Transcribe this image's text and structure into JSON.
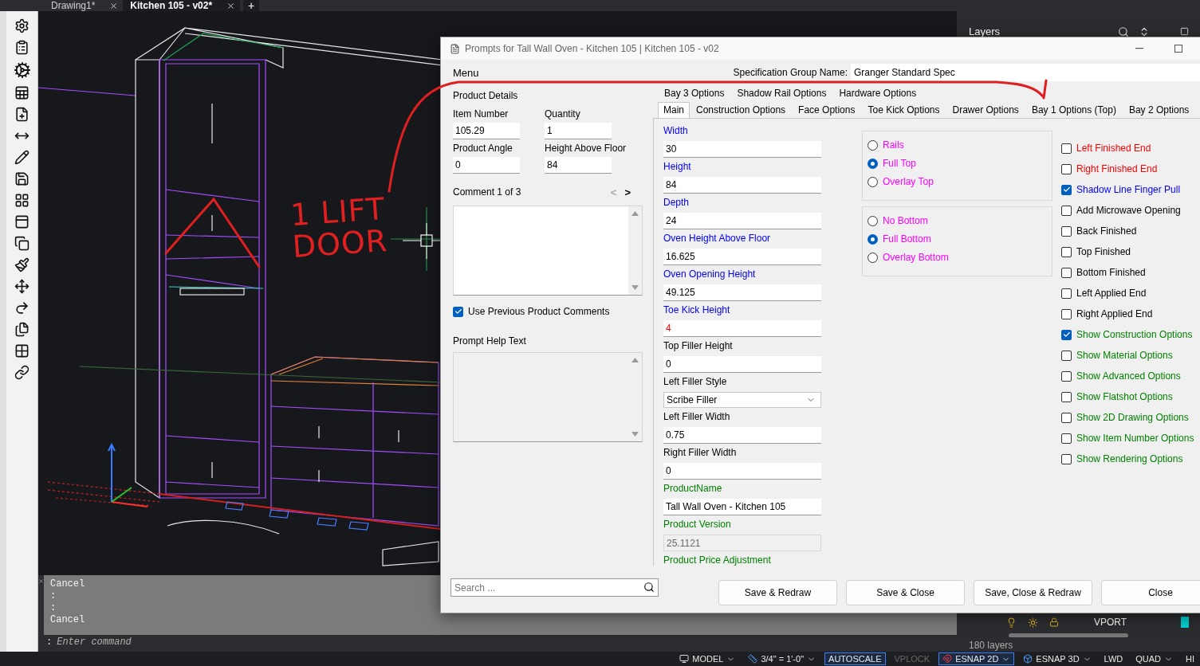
{
  "doc_tabs": [
    {
      "label": "Drawing1*",
      "selected": false
    },
    {
      "label": "Kitchen 105 - v02*",
      "selected": true
    }
  ],
  "new_tab": "+",
  "markup": {
    "note": "1 LIFT DOOR"
  },
  "command_line": {
    "history": [
      "Cancel",
      ":",
      ":",
      "Cancel"
    ],
    "prompt": ":",
    "placeholder": "Enter command"
  },
  "layers_panel": {
    "title": "Layers",
    "row": {
      "name": "VPORT",
      "color": "#00d0d0"
    },
    "count": "180 layers"
  },
  "status_bar": [
    {
      "label": "MODEL",
      "on": false,
      "disabled": false,
      "caret": true
    },
    {
      "label": "3/4\" = 1'-0\"",
      "on": false,
      "disabled": false,
      "caret": true
    },
    {
      "label": "AUTOSCALE",
      "on": true,
      "disabled": false,
      "caret": false
    },
    {
      "label": "VPLOCK",
      "on": false,
      "disabled": true,
      "caret": false
    },
    {
      "label": "ESNAP 2D",
      "on": true,
      "disabled": false,
      "caret": true
    },
    {
      "label": "ESNAP 3D",
      "on": false,
      "disabled": false,
      "caret": true
    },
    {
      "label": "LWD",
      "on": false,
      "disabled": false,
      "caret": false
    },
    {
      "label": "QUAD",
      "on": false,
      "disabled": false,
      "caret": true
    },
    {
      "label": "HI",
      "on": false,
      "disabled": false,
      "caret": false
    }
  ],
  "dialog": {
    "title": "Prompts for Tall Wall Oven - Kitchen 105 | Kitchen 105 - v02",
    "menu": "Menu",
    "spec_label": "Specification Group Name:",
    "spec_value": "Granger Standard Spec",
    "product_details": {
      "title": "Product Details",
      "fields": [
        {
          "label": "Item Number",
          "value": "105.29"
        },
        {
          "label": "Quantity",
          "value": "1"
        },
        {
          "label": "Product Angle",
          "value": "0"
        },
        {
          "label": "Height Above Floor",
          "value": "84"
        }
      ]
    },
    "comment": {
      "label": "Comment 1 of 3",
      "prev": {
        "text": "<",
        "disabled": true
      },
      "next": {
        "text": ">",
        "disabled": false
      }
    },
    "use_previous": {
      "label": "Use Previous Product Comments",
      "checked": true
    },
    "help_label": "Prompt Help Text",
    "search": {
      "placeholder": "Search ..."
    },
    "tab_rows": [
      [
        {
          "label": "Bay 3 Options",
          "selected": false
        },
        {
          "label": "Shadow Rail Options",
          "selected": false
        },
        {
          "label": "Hardware Options",
          "selected": false
        }
      ],
      [
        {
          "label": "Main",
          "selected": true
        },
        {
          "label": "Construction Options",
          "selected": false
        },
        {
          "label": "Face Options",
          "selected": false
        },
        {
          "label": "Toe Kick Options",
          "selected": false
        },
        {
          "label": "Drawer Options",
          "selected": false
        },
        {
          "label": "Bay 1 Options (Top)",
          "selected": false
        },
        {
          "label": "Bay 2 Options",
          "selected": false
        }
      ]
    ],
    "fields": [
      {
        "label": "Width",
        "color": "#0000ff",
        "kind": "text",
        "value": "30",
        "highlighted": false
      },
      {
        "label": "Height",
        "color": "#0000ff",
        "kind": "text",
        "value": "84",
        "highlighted": false
      },
      {
        "label": "Depth",
        "color": "#0000ff",
        "kind": "text",
        "value": "24",
        "highlighted": false
      },
      {
        "label": "Oven Height Above Floor",
        "color": "#0000ff",
        "kind": "text",
        "value": "16.625",
        "highlighted": false
      },
      {
        "label": "Oven Opening Height",
        "color": "#0000ff",
        "kind": "text",
        "value": "49.125",
        "highlighted": false
      },
      {
        "label": "Toe Kick Height",
        "color": "#0000ff",
        "kind": "text",
        "value": "4",
        "highlighted": true
      },
      {
        "label": "Top Filler Height",
        "color": "#000000",
        "kind": "text",
        "value": "0",
        "highlighted": false
      },
      {
        "label": "Left Filler Style",
        "color": "#000000",
        "kind": "dropdown",
        "value": "Scribe Filler",
        "highlighted": false
      },
      {
        "label": "Left Filler Width",
        "color": "#000000",
        "kind": "text",
        "value": "0.75",
        "highlighted": false
      },
      {
        "label": "Right Filler Width",
        "color": "#000000",
        "kind": "text",
        "value": "0",
        "highlighted": false
      },
      {
        "label": "ProductName",
        "color": "#008000",
        "kind": "text",
        "value": "Tall Wall Oven - Kitchen 105",
        "highlighted": false
      },
      {
        "label": "Product Version",
        "color": "#008000",
        "kind": "readonly",
        "value": "25.1121",
        "highlighted": false
      },
      {
        "label": "Product Price Adjustment",
        "color": "#008000",
        "kind": "heading"
      }
    ],
    "radio_groups": [
      [
        {
          "label": "Rails",
          "color": "#ff00ff",
          "selected": false
        },
        {
          "label": "Full Top",
          "color": "#ff00ff",
          "selected": true
        },
        {
          "label": "Overlay Top",
          "color": "#ff00ff",
          "selected": false
        }
      ],
      [
        {
          "label": "No Bottom",
          "color": "#ff00ff",
          "selected": false
        },
        {
          "label": "Full Bottom",
          "color": "#ff00ff",
          "selected": true
        },
        {
          "label": "Overlay Bottom",
          "color": "#ff00ff",
          "selected": false
        }
      ]
    ],
    "checkboxes": [
      {
        "label": "Left Finished End",
        "color": "#ff0000",
        "checked": false
      },
      {
        "label": "Right Finished End",
        "color": "#ff0000",
        "checked": false
      },
      {
        "label": "Shadow Line Finger Pull",
        "color": "#0000ff",
        "checked": true
      },
      {
        "label": "Add Microwave Opening",
        "color": "#000000",
        "checked": false
      },
      {
        "label": "Back Finished",
        "color": "#000000",
        "checked": false
      },
      {
        "label": "Top Finished",
        "color": "#000000",
        "checked": false
      },
      {
        "label": "Bottom Finished",
        "color": "#000000",
        "checked": false
      },
      {
        "label": "Left Applied End",
        "color": "#000000",
        "checked": false
      },
      {
        "label": "Right Applied End",
        "color": "#000000",
        "checked": false
      },
      {
        "label": "Show Construction Options",
        "color": "#008000",
        "checked": true
      },
      {
        "label": "Show Material Options",
        "color": "#008000",
        "checked": false
      },
      {
        "label": "Show Advanced Options",
        "color": "#008000",
        "checked": false
      },
      {
        "label": "Show Flatshot Options",
        "color": "#008000",
        "checked": false
      },
      {
        "label": "Show 2D Drawing Options",
        "color": "#008000",
        "checked": false
      },
      {
        "label": "Show Item Number Options",
        "color": "#008000",
        "checked": false
      },
      {
        "label": "Show Rendering Options",
        "color": "#008000",
        "checked": false
      }
    ],
    "buttons": [
      "Save & Redraw",
      "Save & Close",
      "Save, Close & Redraw",
      "Close"
    ]
  }
}
